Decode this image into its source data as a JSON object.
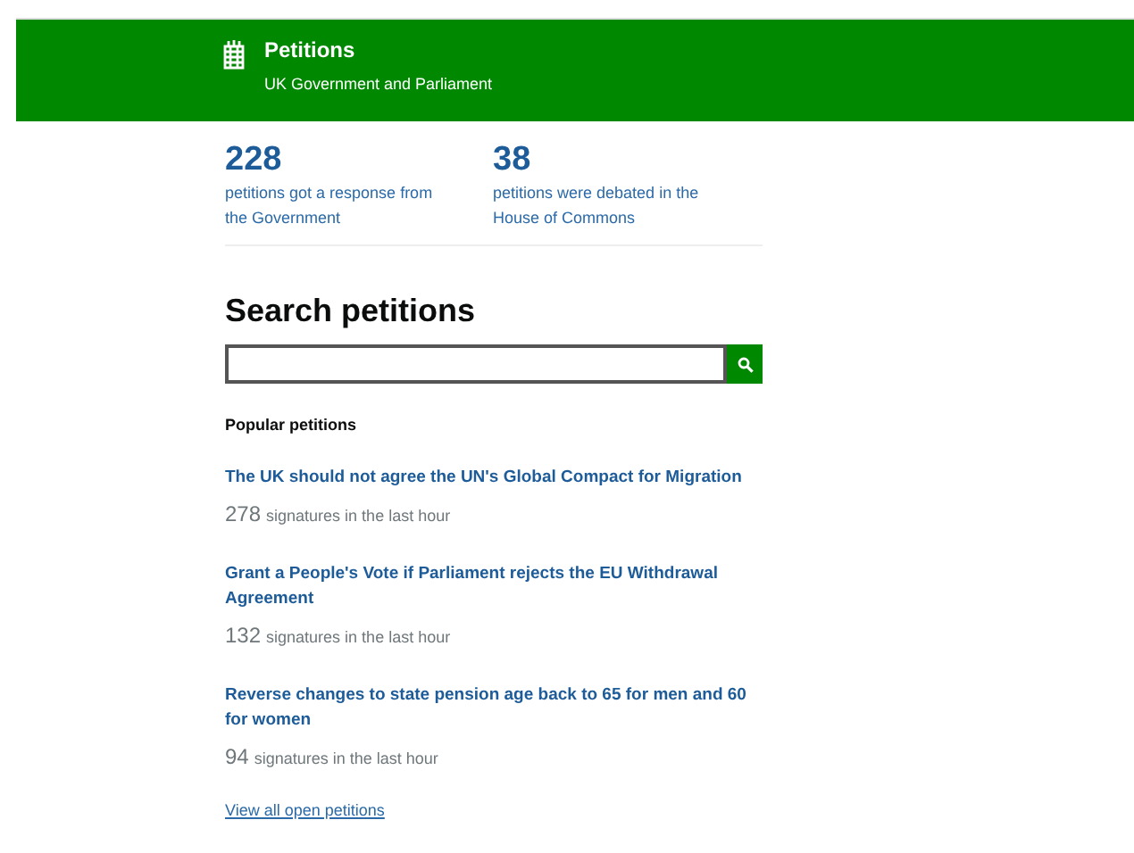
{
  "header": {
    "title": "Petitions",
    "subtitle": "UK Government and Parliament"
  },
  "stats": [
    {
      "number": "228",
      "text": "petitions got a response from the Government"
    },
    {
      "number": "38",
      "text": "petitions were debated in the House of Commons"
    }
  ],
  "search": {
    "heading": "Search petitions"
  },
  "popular": {
    "heading": "Popular petitions",
    "items": [
      {
        "title": "The UK should not agree the UN's Global Compact for Migration",
        "count": "278",
        "label": "signatures in the last hour"
      },
      {
        "title": "Grant a People's Vote if Parliament rejects the EU Withdrawal Agreement",
        "count": "132",
        "label": "signatures in the last hour"
      },
      {
        "title": "Reverse changes to state pension age back to 65 for men and 60 for women",
        "count": "94",
        "label": "signatures in the last hour"
      }
    ],
    "link": "View all open petitions"
  }
}
